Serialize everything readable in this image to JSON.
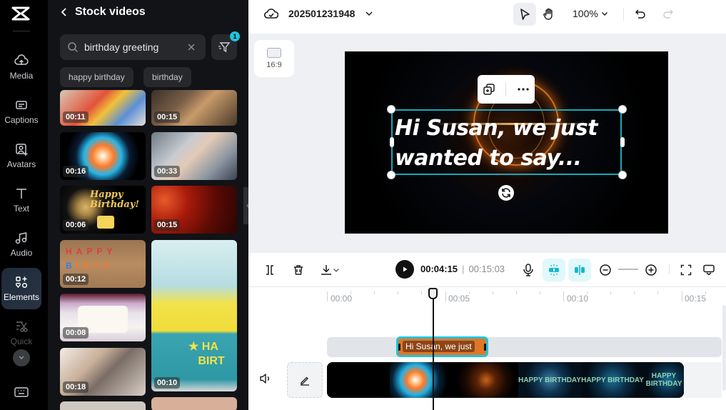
{
  "rail": {
    "items": [
      {
        "label": "Media",
        "icon": "cloud-upload-icon"
      },
      {
        "label": "Captions",
        "icon": "captions-icon"
      },
      {
        "label": "Avatars",
        "icon": "avatar-icon"
      },
      {
        "label": "Text",
        "icon": "text-icon"
      },
      {
        "label": "Audio",
        "icon": "music-icon"
      },
      {
        "label": "Elements",
        "icon": "elements-icon",
        "active": true
      },
      {
        "label": "Quick",
        "icon": "quick-cut-icon"
      }
    ]
  },
  "panel": {
    "title": "Stock videos",
    "search_value": "birthday greeting",
    "filter_count": "1",
    "chips": [
      "happy birthday",
      "birthday"
    ],
    "videos_left": [
      {
        "duration": "00:11",
        "subject": "kids party"
      },
      {
        "duration": "00:16",
        "subject": "firework burst"
      },
      {
        "duration": "00:06",
        "subject": "happy birthday cake"
      },
      {
        "duration": "00:12",
        "subject": "birthday candles"
      },
      {
        "duration": "00:08",
        "subject": "white cake"
      },
      {
        "duration": "00:18",
        "subject": "girl decorating"
      }
    ],
    "videos_right": [
      {
        "duration": "00:15",
        "subject": "party hats"
      },
      {
        "duration": "00:33",
        "subject": "girl confetti"
      },
      {
        "duration": "00:15",
        "subject": "lanterns"
      },
      {
        "duration": "00:10",
        "subject": "birthday cake corgi"
      }
    ]
  },
  "topbar": {
    "project_name": "202501231948",
    "zoom": "100%"
  },
  "canvas": {
    "aspect_ratio": "16:9",
    "caption_line1": "Hi Susan, we just",
    "caption_line2": "wanted to say..."
  },
  "controls": {
    "current_time": "00:04:15",
    "separator": "|",
    "total_time": "00:15:03"
  },
  "timeline": {
    "ticks": [
      "00:00",
      "00:05",
      "00:10",
      "00:15"
    ],
    "text_clip": "Hi Susan, we just",
    "video_frames": [
      "",
      "",
      "",
      "HAPPY BIRTHDAY",
      "HAPPY BIRTHDAY",
      "HAPPY BIRTHDAY"
    ]
  },
  "colors": {
    "accent": "#1ec4dd",
    "text_clip": "#e07628"
  }
}
